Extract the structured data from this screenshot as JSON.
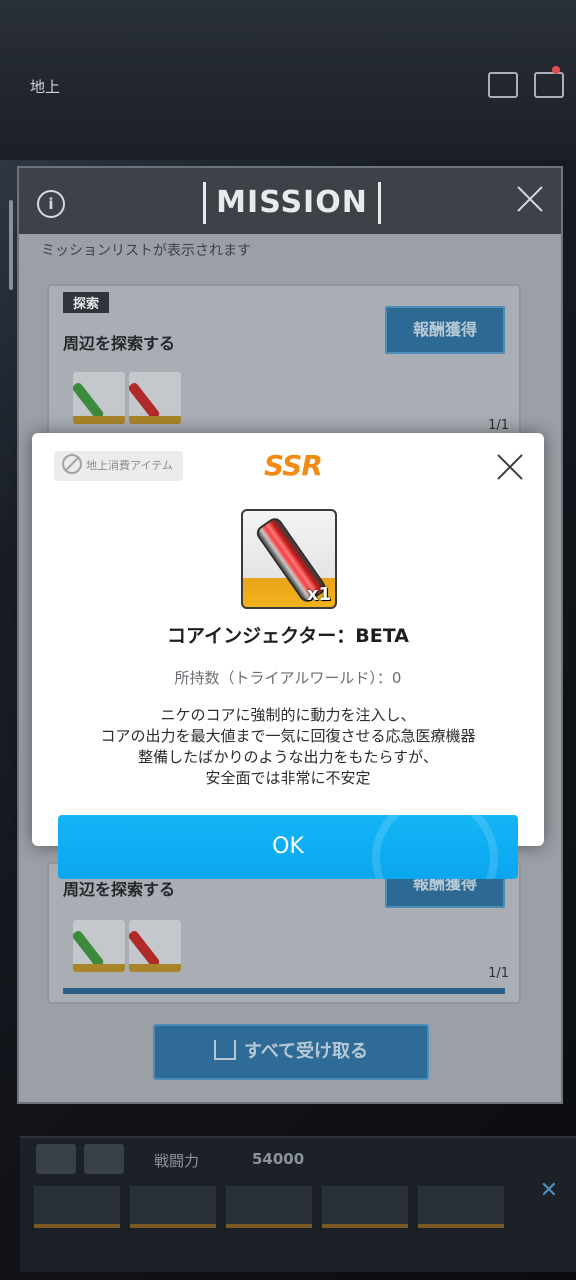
{
  "background": {
    "location_label": "地上"
  },
  "mission_panel": {
    "title": "MISSION",
    "subtitle": "ミッションリストが表示されます",
    "cards": [
      {
        "tag": "探索",
        "title": "周辺を探索する",
        "reward_button": "報酬獲得",
        "count": "1/1"
      },
      {
        "tag": "",
        "title": "周辺を探索する",
        "reward_button": "報酬獲得",
        "count": "1/1"
      }
    ],
    "claim_all_button": "すべて受け取る"
  },
  "squad_bar": {
    "power_label": "戦闘力",
    "power_value": "54000"
  },
  "dialog": {
    "category": "地上消費アイテム",
    "rarity": "SSR",
    "item": {
      "name": "コアインジェクター：BETA",
      "quantity": "x1",
      "icon": "red-injector-icon"
    },
    "owned": "所持数（トライアルワールド）：0",
    "description": [
      "ニケのコアに強制的に動力を注入し、",
      "コアの出力を最大値まで一気に回復させる応急医療機器",
      "整備したばかりのような出力をもたらすが、",
      "安全面では非常に不安定"
    ],
    "ok_button": "OK"
  },
  "colors": {
    "ok_button": "#0aa6ee",
    "rarity_ssr": "#f28a14",
    "item_frame_bottom": "#f2b31e"
  }
}
